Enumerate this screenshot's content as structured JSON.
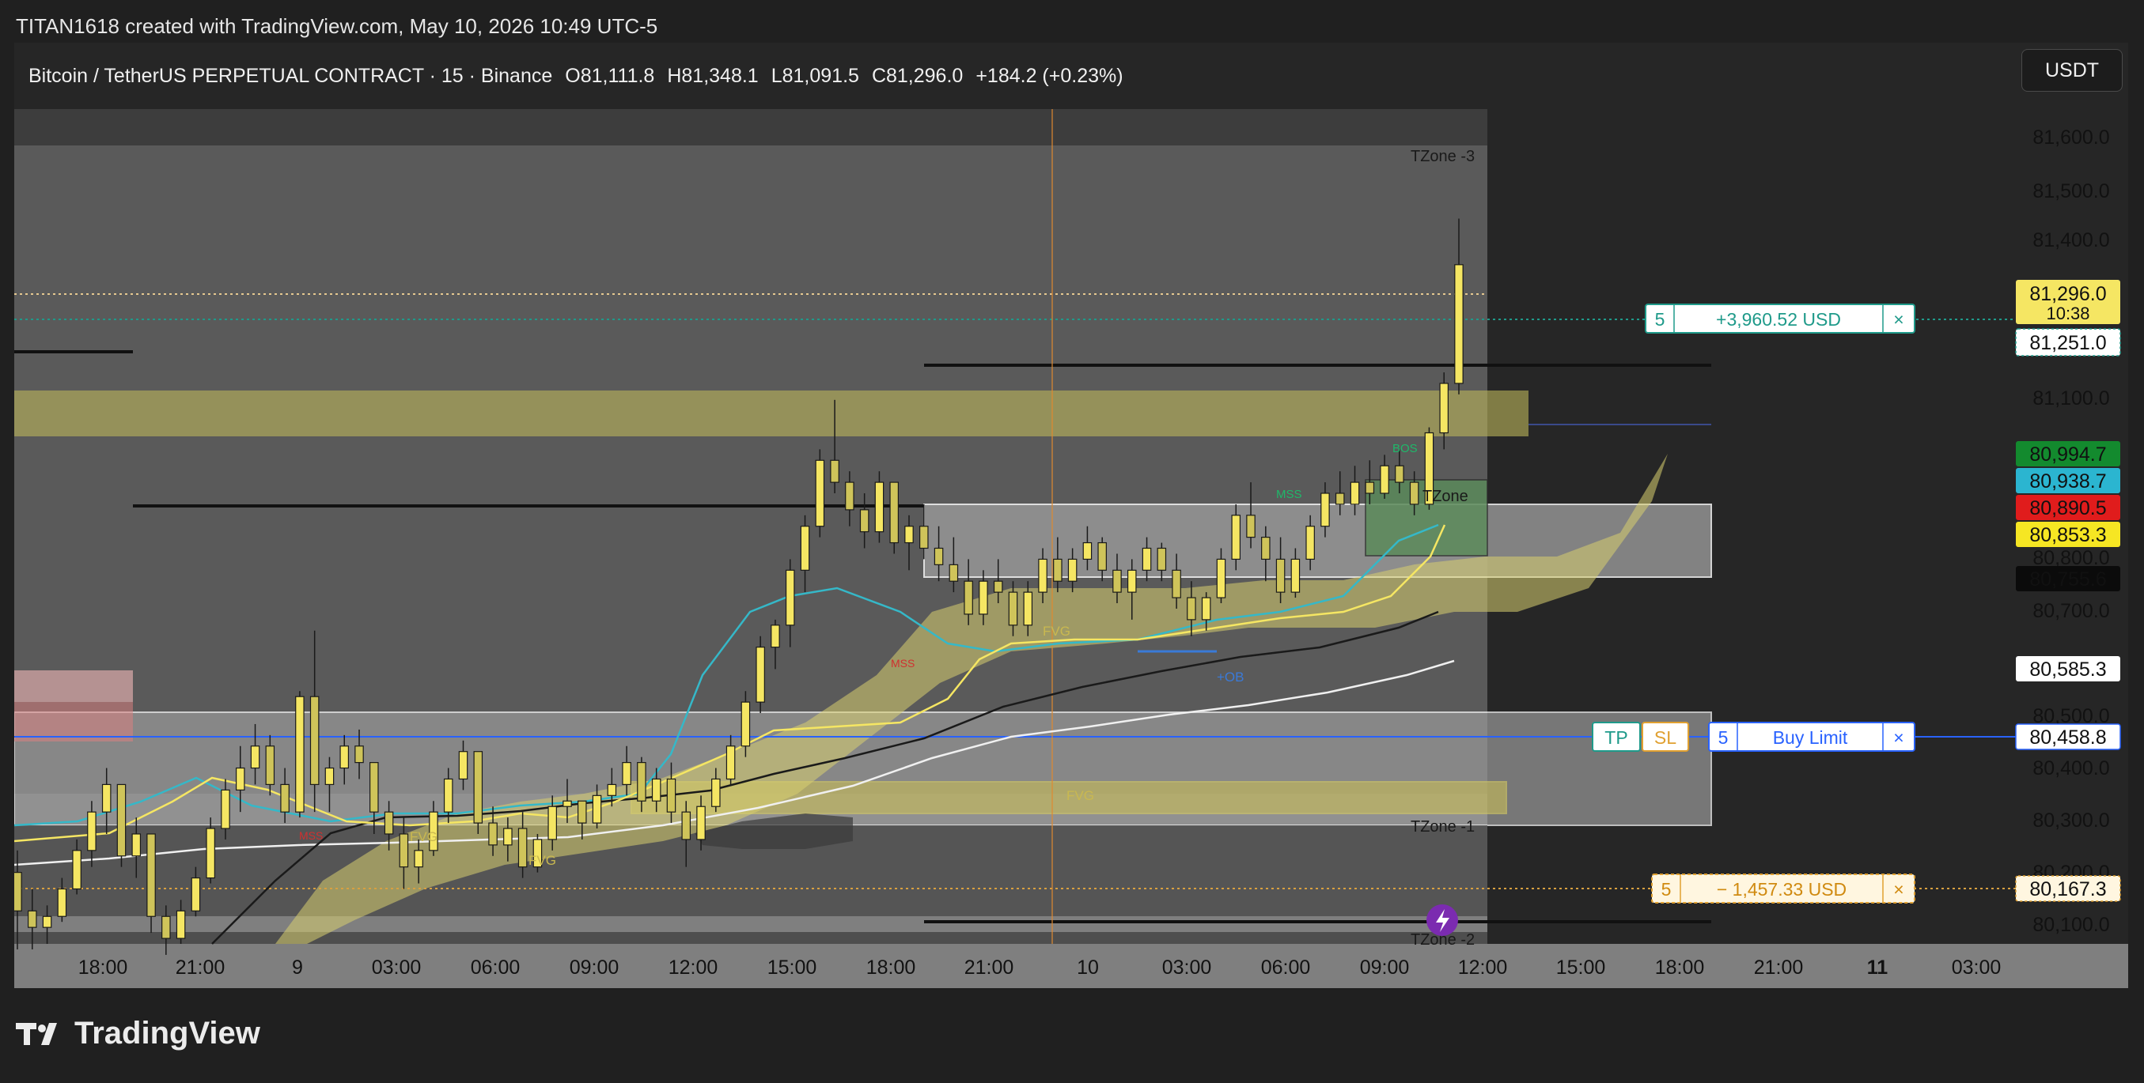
{
  "header": {
    "credit": "TITAN1618 created with TradingView.com, May 10, 2026 10:49 UTC-5"
  },
  "symbol": {
    "name": "Bitcoin / TetherUS PERPETUAL CONTRACT · 15 · Binance",
    "open": "O81,111.8",
    "high": "H81,348.1",
    "low": "L81,091.5",
    "close": "C81,296.0",
    "change": "+184.2 (+0.23%)"
  },
  "toolbar": {
    "currency": "USDT"
  },
  "footer": {
    "brand": "TradingView"
  },
  "colors": {
    "candle_fill": "#f5e663",
    "candle_wick": "#1a1a1a",
    "ema_cyan": "#35b8c8",
    "ema_yellow": "#f5e663",
    "sma_black": "#1a1a1a",
    "sma_white": "#f0f0f0",
    "buy_limit": "#2962ff",
    "tp": "#1f9a8a",
    "sl": "#e0a030"
  },
  "chart_data": {
    "type": "candlestick",
    "x_labels": [
      "18:00",
      "21:00",
      "9",
      "03:00",
      "06:00",
      "09:00",
      "12:00",
      "15:00",
      "18:00",
      "21:00",
      "10",
      "03:00",
      "06:00",
      "09:00",
      "12:00",
      "15:00",
      "18:00",
      "21:00",
      "11",
      "03:00"
    ],
    "y_ticks": [
      "81,600.0",
      "81,500.0",
      "81,400.0",
      "81,100.0",
      "80,800.0",
      "80,700.0",
      "80,500.0",
      "80,400.0",
      "80,300.0",
      "80,200.0",
      "80,100.0"
    ],
    "ylim": [
      80060,
      81700
    ],
    "candles": [
      [
        80190,
        80230,
        80050,
        80120
      ],
      [
        80120,
        80160,
        80050,
        80090
      ],
      [
        80090,
        80130,
        80060,
        80110
      ],
      [
        80110,
        80180,
        80100,
        80160
      ],
      [
        80160,
        80250,
        80150,
        80230
      ],
      [
        80230,
        80320,
        80200,
        80300
      ],
      [
        80300,
        80380,
        80260,
        80350
      ],
      [
        80350,
        80340,
        80200,
        80220
      ],
      [
        80220,
        80290,
        80180,
        80260
      ],
      [
        80260,
        80240,
        80080,
        80110
      ],
      [
        80110,
        80130,
        80040,
        80070
      ],
      [
        80070,
        80140,
        80060,
        80120
      ],
      [
        80120,
        80200,
        80110,
        80180
      ],
      [
        80180,
        80290,
        80170,
        80270
      ],
      [
        80270,
        80360,
        80250,
        80340
      ],
      [
        80340,
        80420,
        80300,
        80380
      ],
      [
        80380,
        80460,
        80350,
        80420
      ],
      [
        80420,
        80440,
        80330,
        80350
      ],
      [
        80350,
        80380,
        80280,
        80300
      ],
      [
        80300,
        80520,
        80290,
        80510
      ],
      [
        80510,
        80630,
        80300,
        80350
      ],
      [
        80350,
        80400,
        80300,
        80380
      ],
      [
        80380,
        80440,
        80350,
        80420
      ],
      [
        80420,
        80450,
        80360,
        80390
      ],
      [
        80390,
        80380,
        80260,
        80300
      ],
      [
        80300,
        80320,
        80230,
        80260
      ],
      [
        80260,
        80290,
        80160,
        80200
      ],
      [
        80200,
        80250,
        80170,
        80230
      ],
      [
        80230,
        80320,
        80220,
        80300
      ],
      [
        80300,
        80380,
        80280,
        80360
      ],
      [
        80360,
        80430,
        80340,
        80410
      ],
      [
        80410,
        80400,
        80260,
        80280
      ],
      [
        80280,
        80310,
        80220,
        80240
      ],
      [
        80240,
        80290,
        80210,
        80270
      ],
      [
        80270,
        80300,
        80180,
        80200
      ],
      [
        80200,
        80260,
        80190,
        80250
      ],
      [
        80250,
        80330,
        80230,
        80310
      ],
      [
        80310,
        80360,
        80280,
        80320
      ],
      [
        80320,
        80310,
        80250,
        80280
      ],
      [
        80280,
        80350,
        80270,
        80330
      ],
      [
        80330,
        80380,
        80310,
        80350
      ],
      [
        80350,
        80420,
        80330,
        80390
      ],
      [
        80390,
        80400,
        80300,
        80320
      ],
      [
        80320,
        80380,
        80300,
        80360
      ],
      [
        80360,
        80390,
        80280,
        80300
      ],
      [
        80300,
        80320,
        80200,
        80250
      ],
      [
        80250,
        80330,
        80230,
        80310
      ],
      [
        80310,
        80380,
        80300,
        80360
      ],
      [
        80360,
        80440,
        80350,
        80420
      ],
      [
        80420,
        80520,
        80400,
        80500
      ],
      [
        80500,
        80620,
        80480,
        80600
      ],
      [
        80600,
        80650,
        80560,
        80640
      ],
      [
        80640,
        80760,
        80600,
        80740
      ],
      [
        80740,
        80840,
        80700,
        80820
      ],
      [
        80820,
        80960,
        80800,
        80940
      ],
      [
        80940,
        81050,
        80880,
        80900
      ],
      [
        80900,
        80920,
        80820,
        80850
      ],
      [
        80850,
        80880,
        80780,
        80810
      ],
      [
        80810,
        80920,
        80790,
        80900
      ],
      [
        80900,
        80880,
        80770,
        80790
      ],
      [
        80790,
        80840,
        80740,
        80820
      ],
      [
        80820,
        80860,
        80760,
        80780
      ],
      [
        80780,
        80820,
        80720,
        80750
      ],
      [
        80750,
        80800,
        80700,
        80720
      ],
      [
        80720,
        80760,
        80640,
        80660
      ],
      [
        80660,
        80740,
        80640,
        80720
      ],
      [
        80720,
        80760,
        80680,
        80700
      ],
      [
        80700,
        80720,
        80620,
        80640
      ],
      [
        80640,
        80720,
        80620,
        80700
      ],
      [
        80700,
        80780,
        80680,
        80760
      ],
      [
        80760,
        80800,
        80700,
        80720
      ],
      [
        80720,
        80780,
        80700,
        80760
      ],
      [
        80760,
        80820,
        80740,
        80790
      ],
      [
        80790,
        80800,
        80720,
        80740
      ],
      [
        80740,
        80770,
        80680,
        80700
      ],
      [
        80700,
        80760,
        80650,
        80740
      ],
      [
        80740,
        80800,
        80720,
        80780
      ],
      [
        80780,
        80790,
        80720,
        80740
      ],
      [
        80740,
        80770,
        80670,
        80690
      ],
      [
        80690,
        80720,
        80620,
        80650
      ],
      [
        80650,
        80700,
        80630,
        80690
      ],
      [
        80690,
        80780,
        80680,
        80760
      ],
      [
        80760,
        80860,
        80740,
        80840
      ],
      [
        80840,
        80900,
        80780,
        80800
      ],
      [
        80800,
        80820,
        80720,
        80760
      ],
      [
        80760,
        80800,
        80680,
        80700
      ],
      [
        80700,
        80780,
        80690,
        80760
      ],
      [
        80760,
        80840,
        80740,
        80820
      ],
      [
        80820,
        80900,
        80800,
        80880
      ],
      [
        80880,
        80920,
        80840,
        80860
      ],
      [
        80860,
        80930,
        80840,
        80900
      ],
      [
        80900,
        80940,
        80860,
        80880
      ],
      [
        80880,
        80950,
        80870,
        80930
      ],
      [
        80930,
        80960,
        80880,
        80900
      ],
      [
        80900,
        80920,
        80840,
        80860
      ],
      [
        80860,
        81000,
        80850,
        80990
      ],
      [
        80990,
        81100,
        80960,
        81080
      ],
      [
        81080,
        81380,
        81060,
        81296
      ]
    ]
  },
  "indicators": {
    "zones": [
      "TZone -3",
      "TZone",
      "TZone -1",
      "TZone -2"
    ],
    "labels": [
      {
        "text": "BOS",
        "color": "#1fb86a"
      },
      {
        "text": "MSS",
        "color": "#1fb86a"
      },
      {
        "text": "MSS",
        "color": "#d03030"
      },
      {
        "text": "MSS",
        "color": "#d03030"
      },
      {
        "text": "FVG",
        "color": "#c9b850"
      },
      {
        "text": "FVG",
        "color": "#c9b850"
      },
      {
        "text": "FVG",
        "color": "#c9b850"
      },
      {
        "text": "FVG",
        "color": "#c9b850"
      },
      {
        "text": "+OB",
        "color": "#3a7ad8"
      }
    ]
  },
  "orders": {
    "tp_position": {
      "qty": "5",
      "pnl": "+3,960.52 USD",
      "close": "×"
    },
    "sl_position": {
      "qty": "5",
      "pnl": "− 1,457.33 USD",
      "close": "×"
    },
    "buy_limit": {
      "tp": "TP",
      "sl": "SL",
      "qty": "5",
      "label": "Buy Limit",
      "close": "×"
    }
  },
  "price_tags": {
    "last": {
      "price": "81,296.0",
      "countdown": "10:38",
      "bg": "#f5e663",
      "fg": "#111111"
    },
    "tp": {
      "price": "81,251.0",
      "bg": "#ffffff",
      "fg": "#1f9a8a"
    },
    "p1": {
      "price": "80,994.7",
      "bg": "#138a2e",
      "fg": "#ffffff"
    },
    "p2": {
      "price": "80,938.7",
      "bg": "#2bb5d0",
      "fg": "#111111"
    },
    "p3": {
      "price": "80,890.5",
      "bg": "#e01c1c",
      "fg": "#ffffff"
    },
    "p4": {
      "price": "80,853.3",
      "bg": "#f6e623",
      "fg": "#111111"
    },
    "p5": {
      "price": "80,755.6",
      "bg": "#0b0b0b",
      "fg": "#ffffff"
    },
    "p6": {
      "price": "80,585.3",
      "bg": "#ffffff",
      "fg": "#111111"
    },
    "buy": {
      "price": "80,458.8",
      "bg": "#ffffff",
      "fg": "#2962ff"
    },
    "sl": {
      "price": "80,167.3",
      "bg": "#fff6e0",
      "fg": "#d08a10"
    }
  }
}
